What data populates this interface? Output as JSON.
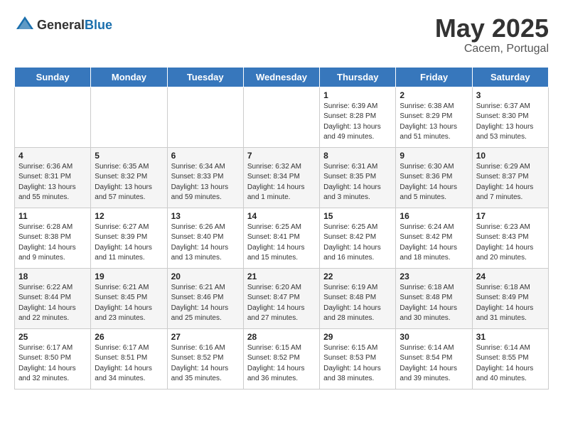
{
  "header": {
    "logo_general": "General",
    "logo_blue": "Blue",
    "month_year": "May 2025",
    "location": "Cacem, Portugal"
  },
  "days_of_week": [
    "Sunday",
    "Monday",
    "Tuesday",
    "Wednesday",
    "Thursday",
    "Friday",
    "Saturday"
  ],
  "weeks": [
    [
      {
        "day": "",
        "info": ""
      },
      {
        "day": "",
        "info": ""
      },
      {
        "day": "",
        "info": ""
      },
      {
        "day": "",
        "info": ""
      },
      {
        "day": "1",
        "info": "Sunrise: 6:39 AM\nSunset: 8:28 PM\nDaylight: 13 hours\nand 49 minutes."
      },
      {
        "day": "2",
        "info": "Sunrise: 6:38 AM\nSunset: 8:29 PM\nDaylight: 13 hours\nand 51 minutes."
      },
      {
        "day": "3",
        "info": "Sunrise: 6:37 AM\nSunset: 8:30 PM\nDaylight: 13 hours\nand 53 minutes."
      }
    ],
    [
      {
        "day": "4",
        "info": "Sunrise: 6:36 AM\nSunset: 8:31 PM\nDaylight: 13 hours\nand 55 minutes."
      },
      {
        "day": "5",
        "info": "Sunrise: 6:35 AM\nSunset: 8:32 PM\nDaylight: 13 hours\nand 57 minutes."
      },
      {
        "day": "6",
        "info": "Sunrise: 6:34 AM\nSunset: 8:33 PM\nDaylight: 13 hours\nand 59 minutes."
      },
      {
        "day": "7",
        "info": "Sunrise: 6:32 AM\nSunset: 8:34 PM\nDaylight: 14 hours\nand 1 minute."
      },
      {
        "day": "8",
        "info": "Sunrise: 6:31 AM\nSunset: 8:35 PM\nDaylight: 14 hours\nand 3 minutes."
      },
      {
        "day": "9",
        "info": "Sunrise: 6:30 AM\nSunset: 8:36 PM\nDaylight: 14 hours\nand 5 minutes."
      },
      {
        "day": "10",
        "info": "Sunrise: 6:29 AM\nSunset: 8:37 PM\nDaylight: 14 hours\nand 7 minutes."
      }
    ],
    [
      {
        "day": "11",
        "info": "Sunrise: 6:28 AM\nSunset: 8:38 PM\nDaylight: 14 hours\nand 9 minutes."
      },
      {
        "day": "12",
        "info": "Sunrise: 6:27 AM\nSunset: 8:39 PM\nDaylight: 14 hours\nand 11 minutes."
      },
      {
        "day": "13",
        "info": "Sunrise: 6:26 AM\nSunset: 8:40 PM\nDaylight: 14 hours\nand 13 minutes."
      },
      {
        "day": "14",
        "info": "Sunrise: 6:25 AM\nSunset: 8:41 PM\nDaylight: 14 hours\nand 15 minutes."
      },
      {
        "day": "15",
        "info": "Sunrise: 6:25 AM\nSunset: 8:42 PM\nDaylight: 14 hours\nand 16 minutes."
      },
      {
        "day": "16",
        "info": "Sunrise: 6:24 AM\nSunset: 8:42 PM\nDaylight: 14 hours\nand 18 minutes."
      },
      {
        "day": "17",
        "info": "Sunrise: 6:23 AM\nSunset: 8:43 PM\nDaylight: 14 hours\nand 20 minutes."
      }
    ],
    [
      {
        "day": "18",
        "info": "Sunrise: 6:22 AM\nSunset: 8:44 PM\nDaylight: 14 hours\nand 22 minutes."
      },
      {
        "day": "19",
        "info": "Sunrise: 6:21 AM\nSunset: 8:45 PM\nDaylight: 14 hours\nand 23 minutes."
      },
      {
        "day": "20",
        "info": "Sunrise: 6:21 AM\nSunset: 8:46 PM\nDaylight: 14 hours\nand 25 minutes."
      },
      {
        "day": "21",
        "info": "Sunrise: 6:20 AM\nSunset: 8:47 PM\nDaylight: 14 hours\nand 27 minutes."
      },
      {
        "day": "22",
        "info": "Sunrise: 6:19 AM\nSunset: 8:48 PM\nDaylight: 14 hours\nand 28 minutes."
      },
      {
        "day": "23",
        "info": "Sunrise: 6:18 AM\nSunset: 8:48 PM\nDaylight: 14 hours\nand 30 minutes."
      },
      {
        "day": "24",
        "info": "Sunrise: 6:18 AM\nSunset: 8:49 PM\nDaylight: 14 hours\nand 31 minutes."
      }
    ],
    [
      {
        "day": "25",
        "info": "Sunrise: 6:17 AM\nSunset: 8:50 PM\nDaylight: 14 hours\nand 32 minutes."
      },
      {
        "day": "26",
        "info": "Sunrise: 6:17 AM\nSunset: 8:51 PM\nDaylight: 14 hours\nand 34 minutes."
      },
      {
        "day": "27",
        "info": "Sunrise: 6:16 AM\nSunset: 8:52 PM\nDaylight: 14 hours\nand 35 minutes."
      },
      {
        "day": "28",
        "info": "Sunrise: 6:15 AM\nSunset: 8:52 PM\nDaylight: 14 hours\nand 36 minutes."
      },
      {
        "day": "29",
        "info": "Sunrise: 6:15 AM\nSunset: 8:53 PM\nDaylight: 14 hours\nand 38 minutes."
      },
      {
        "day": "30",
        "info": "Sunrise: 6:14 AM\nSunset: 8:54 PM\nDaylight: 14 hours\nand 39 minutes."
      },
      {
        "day": "31",
        "info": "Sunrise: 6:14 AM\nSunset: 8:55 PM\nDaylight: 14 hours\nand 40 minutes."
      }
    ]
  ]
}
